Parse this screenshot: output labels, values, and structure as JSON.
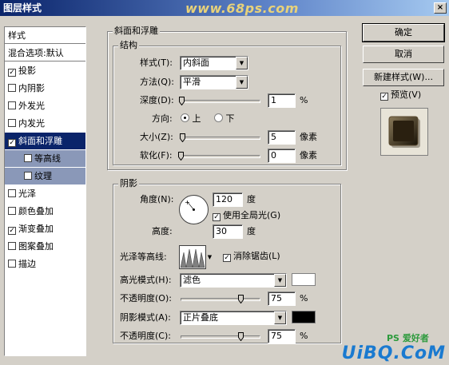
{
  "window": {
    "title": "图层样式",
    "watermark": "www.68ps.com",
    "close": "×"
  },
  "sidebar": {
    "items": [
      {
        "label": "样式",
        "type": "header"
      },
      {
        "label": "混合选项:默认",
        "type": "header"
      },
      {
        "label": "投影",
        "checked": true
      },
      {
        "label": "内阴影",
        "checked": false
      },
      {
        "label": "外发光",
        "checked": false
      },
      {
        "label": "内发光",
        "checked": false
      },
      {
        "label": "斜面和浮雕",
        "checked": true,
        "selected": true
      },
      {
        "label": "等高线",
        "checked": false,
        "sub": true
      },
      {
        "label": "纹理",
        "checked": false,
        "sub": true
      },
      {
        "label": "光泽",
        "checked": false
      },
      {
        "label": "颜色叠加",
        "checked": false
      },
      {
        "label": "渐变叠加",
        "checked": true
      },
      {
        "label": "图案叠加",
        "checked": false
      },
      {
        "label": "描边",
        "checked": false
      }
    ]
  },
  "bevel": {
    "group_title": "斜面和浮雕",
    "structure_title": "结构",
    "style_label": "样式(T):",
    "style_value": "内斜面",
    "technique_label": "方法(Q):",
    "technique_value": "平滑",
    "depth_label": "深度(D):",
    "depth_value": "1",
    "depth_unit": "%",
    "depth_level": 0.01,
    "direction_label": "方向:",
    "direction_up": "上",
    "direction_down": "下",
    "size_label": "大小(Z):",
    "size_value": "5",
    "size_unit": "像素",
    "size_level": 0.02,
    "soften_label": "软化(F):",
    "soften_value": "0",
    "soften_unit": "像素",
    "soften_level": 0
  },
  "shading": {
    "title": "阴影",
    "angle_label": "角度(N):",
    "angle_value": "120",
    "angle_unit": "度",
    "global_light_label": "使用全局光(G)",
    "altitude_label": "高度:",
    "altitude_value": "30",
    "altitude_unit": "度",
    "gloss_label": "光泽等高线:",
    "antialias_label": "消除锯齿(L)",
    "highlight_mode_label": "高光模式(H):",
    "highlight_mode_value": "滤色",
    "highlight_color": "#ffffff",
    "highlight_opacity_label": "不透明度(O):",
    "highlight_opacity_value": "75",
    "highlight_opacity_unit": "%",
    "highlight_opacity_level": 0.75,
    "shadow_mode_label": "阴影模式(A):",
    "shadow_mode_value": "正片叠底",
    "shadow_color": "#000000",
    "shadow_opacity_label": "不透明度(C):",
    "shadow_opacity_value": "75",
    "shadow_opacity_unit": "%",
    "shadow_opacity_level": 0.75
  },
  "buttons": {
    "ok": "确定",
    "cancel": "取消",
    "new_style": "新建样式(W)...",
    "preview": "预览(V)"
  },
  "footer": {
    "logo": "UiBQ.CoM",
    "logo_small": "PS 爱好者"
  }
}
